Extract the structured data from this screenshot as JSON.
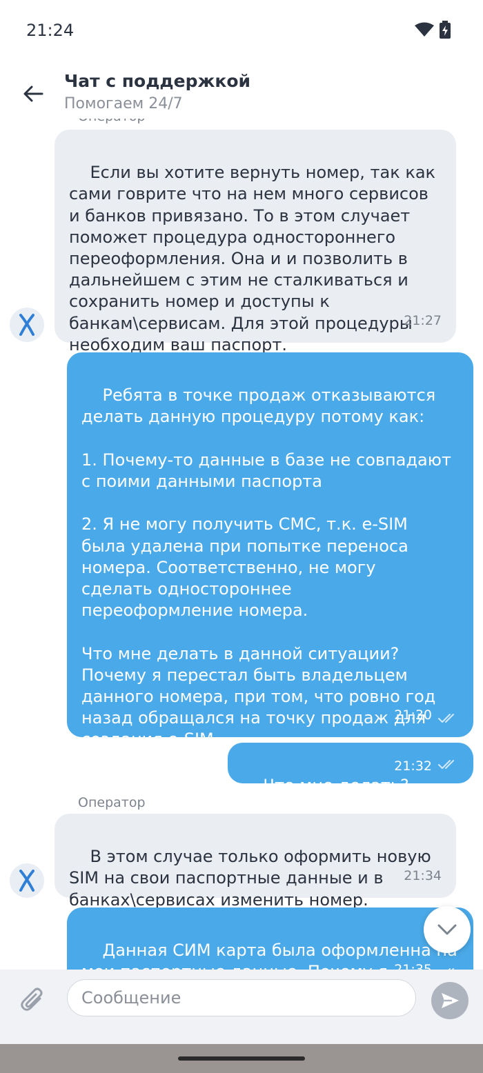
{
  "status_bar": {
    "time": "21:24"
  },
  "header": {
    "title": "Чат с поддержкой",
    "subtitle": "Помогаем 24/7"
  },
  "messages": [
    {
      "side": "in",
      "sender": "Оператор",
      "text": "Если вы хотите вернуть номер, так как\nсами говрите что на нем много сервисов\nи банков привязано. То в этом случает\nпоможет процедура одностороннего\nпереоформления. Она и и позволить в\nдальнейшем с этим не сталкиваться и\nсохранить номер и доступы к\nбанкам\\сервисам. Для этой процедуры\nнеобходим ваш паспорт.",
      "time": "21:27"
    },
    {
      "side": "out",
      "text": "Ребята в точке продаж отказываются\nделать данную процедуру потому как:\n\n1. Почему-то данные в базе не совпадают\nс поими данными паспорта\n\n2. Я не могу получить СМС, т.к. e-SIM\nбыла удалена при попытке переноса\nномера. Соответственно, не могу\nсделать одностороннее\nпереоформление номера.\n\nЧто мне делать в данной ситуации?\nПочему я перестал быть владельцем\nданного номера, при том, что ровно год\nназад обращался на точку продаж для\nсоздания e-SIM",
      "time": "21:30"
    },
    {
      "side": "out",
      "text": "Что мне делать?",
      "time": "21:32"
    },
    {
      "side": "in",
      "sender": "Оператор",
      "text": "В этом случае только оформить новую\nSIM на свои паспортные данные и в\nбанках\\сервисах изменить номер.",
      "time": "21:34"
    },
    {
      "side": "out",
      "text": "Данная СИМ карта была оформленна на\nмои паспортные данные. Почему я\nдолжен оформлять новый номер?",
      "time": "21:35"
    }
  ],
  "composer": {
    "placeholder": "Сообщение"
  },
  "colors": {
    "incoming_bubble": "#eaedf2",
    "outgoing_bubble": "#4aa9e8",
    "send_button": "#aeb4be"
  }
}
